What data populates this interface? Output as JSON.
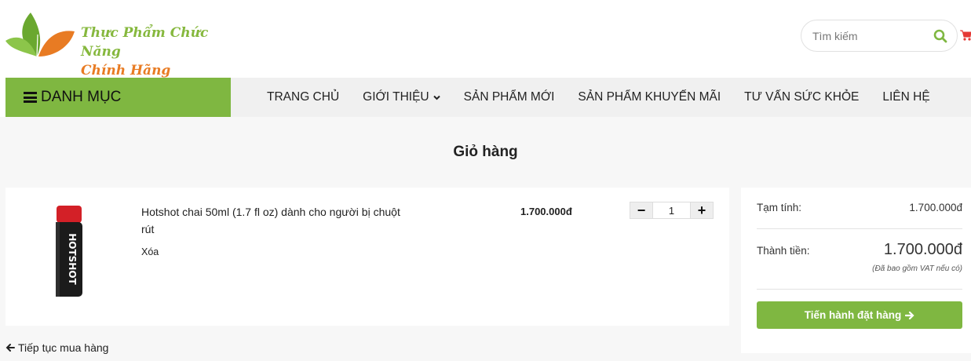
{
  "brand": {
    "line1": "Thực Phẩm Chức Năng",
    "line2": "Chính Hãng"
  },
  "search": {
    "placeholder": "Tìm kiếm"
  },
  "nav": {
    "category_label": "DANH MỤC",
    "items": [
      "TRANG CHỦ",
      "GIỚI THIỆU",
      "SẢN PHẨM MỚI",
      "SẢN PHẨM KHUYẾN MÃI",
      "TƯ VẤN SỨC KHỎE",
      "LIÊN HỆ"
    ]
  },
  "page": {
    "title": "Giỏ hàng"
  },
  "cart": {
    "items": [
      {
        "name": "Hotshot chai 50ml (1.7 fl oz) dành cho người bị chuột rút",
        "remove_label": "Xóa",
        "price": "1.700.000đ",
        "quantity": "1"
      }
    ],
    "qty_minus": "−",
    "qty_plus": "+",
    "continue_label": "Tiếp tục mua hàng"
  },
  "summary": {
    "subtotal_label": "Tạm tính:",
    "subtotal_value": "1.700.000đ",
    "total_label": "Thành tiền:",
    "total_value": "1.700.000đ",
    "vat_note": "(Đã bao gồm VAT nếu có)",
    "checkout_label": "Tiến hành đặt hàng"
  },
  "product_image": {
    "bottle_text": "HOTSHOT"
  },
  "colors": {
    "accent_green": "#7fb741",
    "brand_orange": "#e87b23",
    "cart_red": "#e53935"
  }
}
